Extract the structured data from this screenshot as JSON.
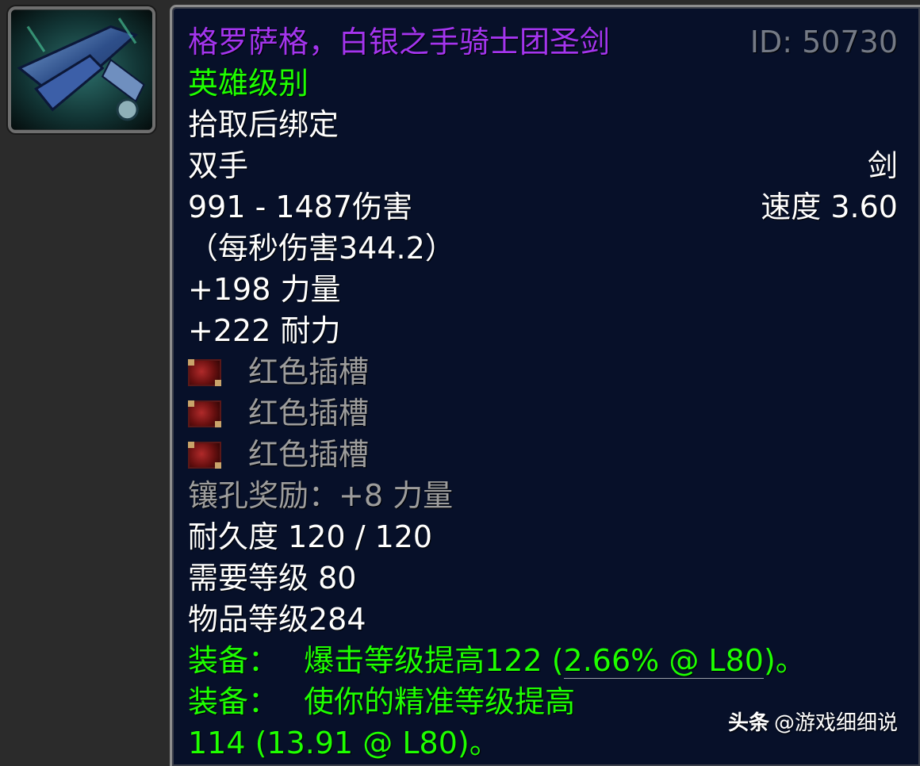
{
  "item": {
    "name": "格罗萨格，白银之手骑士团圣剑",
    "id_label": "ID: 50730",
    "quality": "英雄级别",
    "binding": "拾取后绑定",
    "slot": "双手",
    "weapon_type": "剑",
    "damage": "991 - 1487伤害",
    "speed": "速度 3.60",
    "dps": "（每秒伤害344.2）",
    "stats": [
      "+198 力量",
      "+222 耐力"
    ],
    "sockets": [
      "红色插槽",
      "红色插槽",
      "红色插槽"
    ],
    "socket_bonus": "镶孔奖励：+8 力量",
    "durability": "耐久度 120 / 120",
    "required_level": "需要等级 80",
    "item_level": "物品等级284",
    "equip_1_prefix": "装备：",
    "equip_1_text": "爆击等级提高122 (",
    "equip_1_value": "2.66% @ L80",
    "equip_1_suffix": ")。",
    "equip_2_prefix": "装备：",
    "equip_2_text": "使你的精准等级提高",
    "equip_2_line2": "114 (13.91 @ L80)。"
  },
  "watermark": {
    "brand": "头条",
    "author": "@游戏细细说"
  },
  "colors": {
    "epic_purple": "#a335ee",
    "uncommon_green": "#1eff00",
    "socket_gray": "#9d9d9d",
    "tooltip_bg": "#071029",
    "page_bg": "#2b2b2b"
  },
  "icons": {
    "item_icon": "sword-icon",
    "socket_icon": "red-socket-icon"
  }
}
